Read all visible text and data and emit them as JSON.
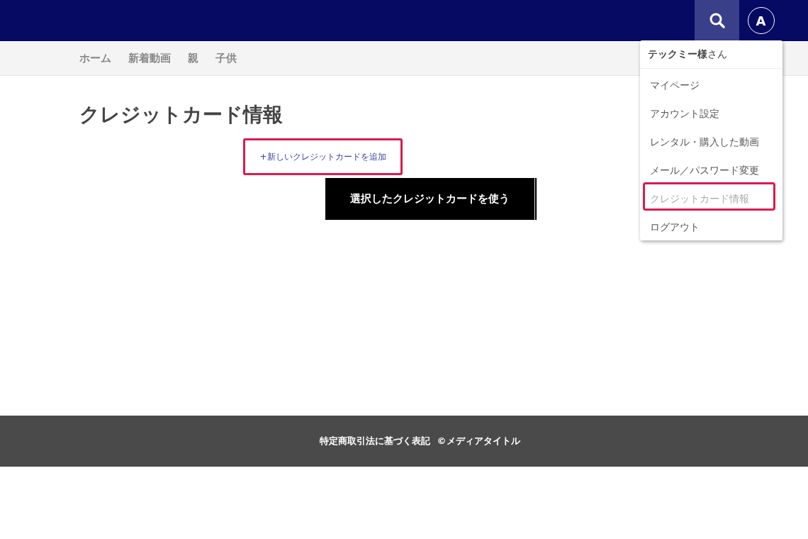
{
  "header": {
    "avatar_letter": "A"
  },
  "nav": {
    "items": [
      {
        "label": "ホーム"
      },
      {
        "label": "新着動画"
      },
      {
        "label": "親"
      },
      {
        "label": "子供"
      }
    ]
  },
  "page": {
    "title": "クレジットカード情報",
    "add_card_link": {
      "label": "+新しいクレジットカードを追加",
      "highlighted": true
    },
    "use_button": "選択したクレジットカードを使う"
  },
  "user_menu": {
    "greeting": "**テックミー様**さん",
    "items": [
      {
        "label": "マイページ",
        "selected": false,
        "highlighted": false
      },
      {
        "label": "アカウント設定",
        "selected": false,
        "highlighted": false
      },
      {
        "label": "レンタル・購入した動画",
        "selected": false,
        "highlighted": false
      },
      {
        "label": "メール／パスワード変更",
        "selected": false,
        "highlighted": false
      },
      {
        "label": "クレジットカード情報",
        "selected": true,
        "highlighted": true
      },
      {
        "label": "ログアウト",
        "selected": false,
        "highlighted": false
      }
    ]
  },
  "footer": {
    "links": [
      "特定商取引法に基づく表記"
    ],
    "copyright": "©メディアタイトル"
  }
}
